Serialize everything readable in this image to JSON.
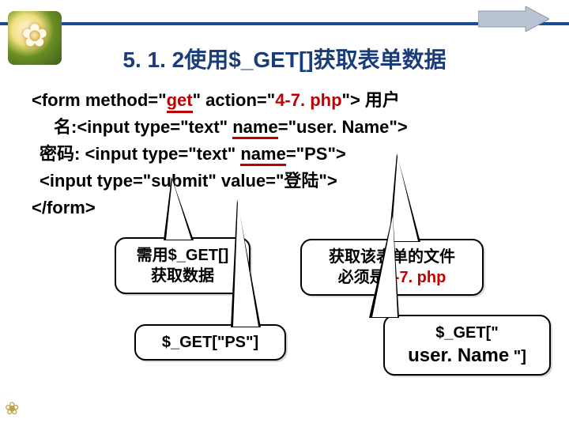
{
  "title": "5. 1. 2使用$_GET[]获取表单数据",
  "code": {
    "l1a": "<form method=\"",
    "l1_get": "get",
    "l1b": "\" action=\"",
    "l1_action": "4-7. php",
    "l1c": "\">  用户",
    "l2a": "名:<input type=\"text\" ",
    "l2_name": "name",
    "l2b": "=\"user. Name\">",
    "l3a": "密码: <input type=\"text\" ",
    "l3_name": "name",
    "l3b": "=\"PS\">",
    "l4": "<input type=\"submit\" value=\"登陆\">",
    "l5": "</form>"
  },
  "callouts": {
    "c1_line1": "需用$_GET[]",
    "c1_line2": "获取数据",
    "c2_line1": "获取该表单的文件",
    "c2_line2a": "必须是",
    "c2_line2b": "4-7. php",
    "c3": "$_GET[\"PS\"]",
    "c4a": "$_GET[\"",
    "c4b": "user. Name",
    "c4c": " \"]"
  }
}
